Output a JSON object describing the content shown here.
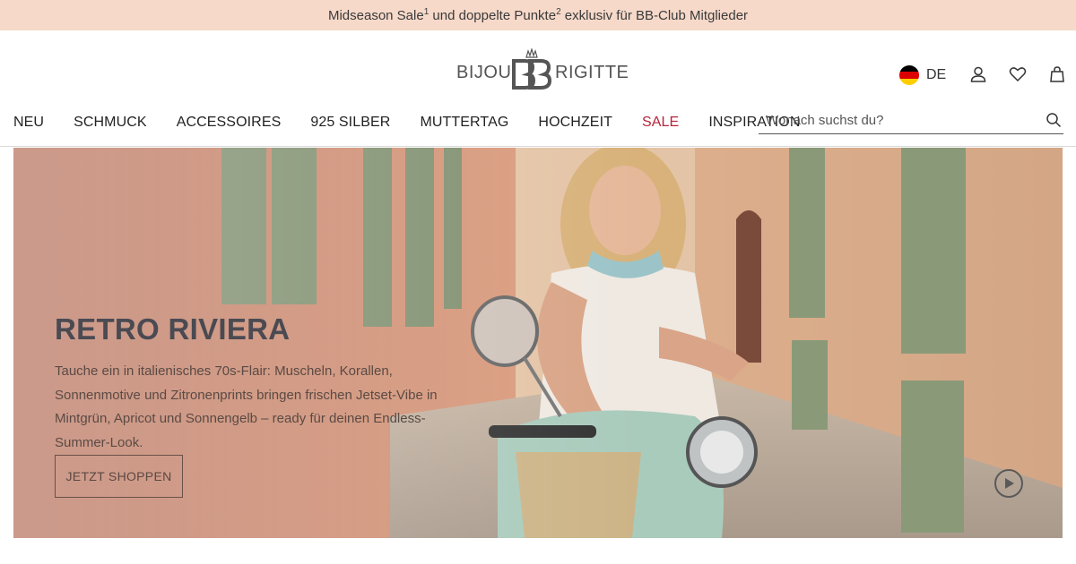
{
  "promo": {
    "part1": "Midseason Sale",
    "sup1": "1",
    "part2": " und doppelte Punkte",
    "sup2": "2",
    "part3": " exklusiv für BB-Club Mitglieder"
  },
  "brand": {
    "left_word": "BIJOU",
    "right_word": "RIGITTE",
    "monogram": "BB"
  },
  "header": {
    "language": "DE",
    "flag_colors": [
      "#000000",
      "#dd0000",
      "#ffce00"
    ]
  },
  "nav": {
    "items": [
      {
        "label": "NEU"
      },
      {
        "label": "SCHMUCK"
      },
      {
        "label": "ACCESSOIRES"
      },
      {
        "label": "925 SILBER"
      },
      {
        "label": "MUTTERTAG"
      },
      {
        "label": "HOCHZEIT"
      },
      {
        "label": "SALE"
      },
      {
        "label": "INSPIRATION"
      }
    ]
  },
  "search": {
    "placeholder": "Wonach suchst du?",
    "value": ""
  },
  "hero": {
    "title": "RETRO RIVIERA",
    "text": "Tauche ein in italienisches 70s-Flair: Muscheln, Korallen, Sonnenmotive und Zitronenprints bringen frischen Jetset-Vibe in Mintgrün, Apricot und Sonnengelb – ready für deinen Endless-Summer-Look.",
    "cta": "JETZT SHOPPEN"
  },
  "colors": {
    "promo_bg": "#f6d9c9",
    "sale_red": "#b8243b",
    "text_dark": "#222222"
  },
  "icons": [
    "user-icon",
    "heart-icon",
    "bag-icon",
    "search-icon",
    "play-icon"
  ]
}
